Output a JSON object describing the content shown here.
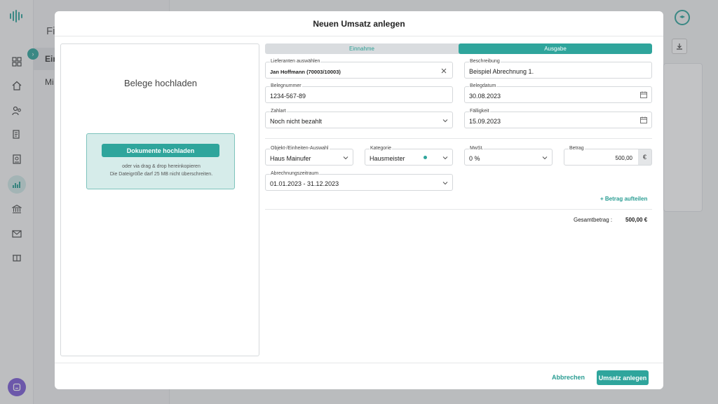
{
  "background": {
    "subnav_title": "Fi",
    "subnav_items": [
      "Ein",
      "Mi"
    ]
  },
  "modal": {
    "title": "Neuen Umsatz anlegen",
    "upload": {
      "title": "Belege hochladen",
      "button_label": "Dokumente hochladen",
      "hint_line1": "oder via drag & drop hereinkopieren",
      "hint_line2": "Die Dateigröße darf 25 MB nicht überschreiten."
    },
    "toggle": {
      "income_label": "Einnahme",
      "expense_label": "Ausgabe",
      "selected": "Ausgabe"
    },
    "fields": {
      "supplier": {
        "label": "Lieferanten auswählen",
        "value": "Jan Hoffmann (70003/10003)"
      },
      "description": {
        "label": "Beschreibung",
        "value": "Beispiel Abrechnung 1."
      },
      "receipt_number": {
        "label": "Belegnummer",
        "value": "1234-567-89"
      },
      "receipt_date": {
        "label": "Belegdatum",
        "value": "30.08.2023"
      },
      "payment_type": {
        "label": "Zahlart",
        "value": "Noch nicht bezahlt"
      },
      "due_date": {
        "label": "Fälligkeit",
        "value": "15.09.2023"
      },
      "object": {
        "label": "Objekt-/Einheiten-Auswahl",
        "value": "Haus Mainufer"
      },
      "category": {
        "label": "Kategorie",
        "value": "Hausmeister"
      },
      "vat": {
        "label": "MwSt.",
        "value": "0 %"
      },
      "amount": {
        "label": "Betrag",
        "value": "500,00",
        "currency": "€"
      },
      "billing_period": {
        "label": "Abrechnungszeitraum",
        "value": "01.01.2023 - 31.12.2023"
      }
    },
    "split_link": "+ Betrag aufteilen",
    "total_label": "Gesamtbetrag :",
    "total_value": "500,00 €",
    "cancel_label": "Abbrechen",
    "submit_label": "Umsatz anlegen"
  },
  "colors": {
    "accent": "#2fa59c",
    "accent_light": "#d6ecea"
  }
}
